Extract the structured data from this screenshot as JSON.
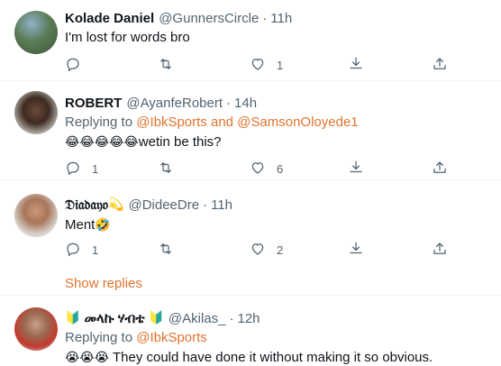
{
  "tweets": [
    {
      "name": "Kolade Daniel",
      "handle": "@GunnersCircle",
      "dot": "·",
      "time": "11h",
      "text": "I'm lost for words bro",
      "replies": "",
      "likes": "1"
    },
    {
      "name": "ROBERT",
      "handle": "@AyanfeRobert",
      "dot": "·",
      "time": "14h",
      "reply_prefix": "Replying to ",
      "reply_link": "@IbkSports and @SamsonOloyede1",
      "emojis": "😂😂😂😂😂",
      "text": "wetin be this?",
      "replies": "1",
      "likes": "6"
    },
    {
      "name": "𝔇𝔦𝔞𝔡𝔞𝔶𝔬",
      "name_emoji": "💫",
      "handle": "@DideeDre",
      "dot": "·",
      "time": "11h",
      "text": "Ment",
      "text_emoji": "🤣",
      "replies": "1",
      "likes": "2"
    },
    {
      "name_prefix_emoji": "🔰",
      "name": "መላኩ ሃብቴ",
      "name_emoji": "🔰",
      "handle": "@Akilas_",
      "dot": "·",
      "time": "12h",
      "reply_prefix": "Replying to ",
      "reply_link": "@IbkSports",
      "emojis": "😭😭😭",
      "text": "They could have done it without making it so obvious."
    }
  ],
  "show_replies": "Show replies",
  "icons": {
    "reply": "reply-icon",
    "retweet": "retweet-icon",
    "like": "like-icon",
    "share": "share-icon",
    "upload": "upload-icon"
  },
  "colors": {
    "link": "#e0732e",
    "muted": "#536471",
    "text": "#0f1419"
  }
}
